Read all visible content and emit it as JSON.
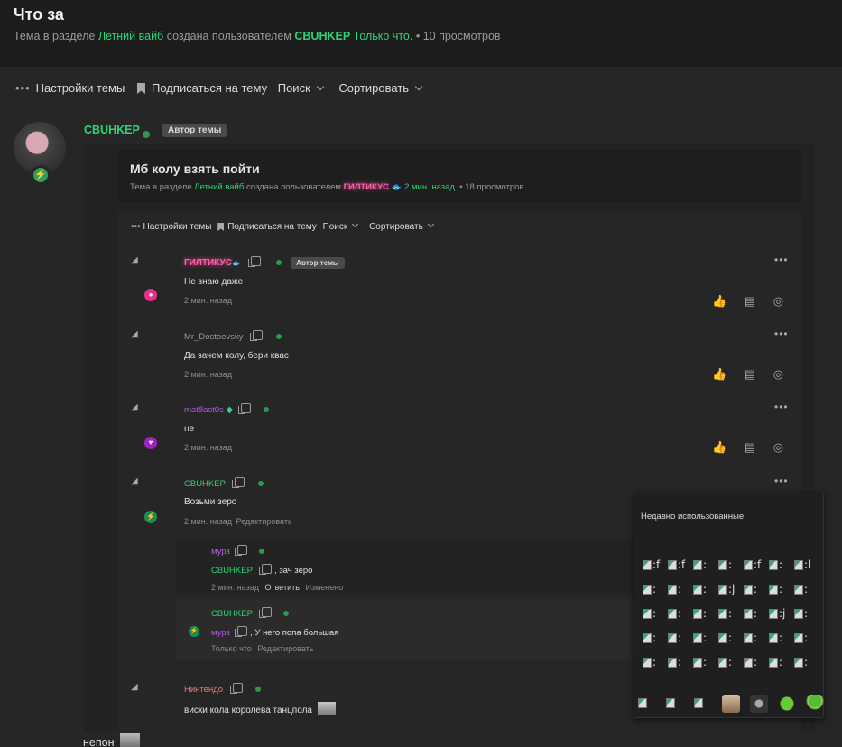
{
  "header": {
    "title": "Что за",
    "meta_prefix": "Тема в разделе",
    "section": "Летний вайб",
    "created_by": "создана пользователем",
    "author": "CBUHKEP",
    "time": "Только что.",
    "views": "• 10 просмотров"
  },
  "toolbar": {
    "settings": "Настройки темы",
    "subscribe": "Подписаться на тему",
    "search": "Поиск",
    "sort": "Сортировать"
  },
  "post": {
    "author": "CBUHKEP",
    "badge": "Автор темы",
    "avatar_badge": "bolt-icon"
  },
  "quoted_thread": {
    "title": "Мб колу взять пойти",
    "meta_prefix": "Тема в разделе",
    "section": "Летний вайб",
    "created_by": "создана пользователем",
    "author": "ГИЛТИКУС",
    "time": "2 мин. назад.",
    "views": "• 18 просмотров",
    "toolbar": {
      "settings": "Настройки темы",
      "subscribe": "Подписаться на тему",
      "search": "Поиск",
      "sort": "Сортировать"
    }
  },
  "comments": [
    {
      "author": "ГИЛТИКУС",
      "badge": "Автор темы",
      "text": "Не знаю даже",
      "time": "2 мин. назад",
      "icon": "apple-badge-icon"
    },
    {
      "author": "Mr_Dostoevsky",
      "text": "Да зачем колу, бери квас",
      "time": "2 мин. назад"
    },
    {
      "author": "mat8ast0s",
      "text": "не",
      "time": "2 мин. назад",
      "icon": "heart-badge-icon"
    },
    {
      "author": "CBUHKEP",
      "text": "Возьми зеро",
      "time": "2 мин. назад",
      "edit": "Редактировать",
      "icon": "bolt-badge-icon"
    },
    {
      "author": "Нинтендо",
      "text": "виски кола королева танцпола"
    }
  ],
  "replies": [
    {
      "author": "мурз",
      "quote_author": "CBUHKEP",
      "text": ", зач зеро",
      "time": "2 мин. назад",
      "reply": "Ответить",
      "changed": "Изменено"
    },
    {
      "author": "CBUHKEP",
      "quote_author": "мурз",
      "text": ", У него попа большая",
      "time": "Только что",
      "edit": "Редактировать"
    }
  ],
  "emoji_panel": {
    "title": "Недавно использованные",
    "rows": [
      [
        ":f",
        ":f",
        ":",
        ":",
        ":f",
        ":",
        ":l"
      ],
      [
        ":",
        ":",
        ":",
        ":j",
        ":",
        ":",
        ":"
      ],
      [
        ":",
        ":",
        ":",
        ":",
        ":",
        ":j",
        ":"
      ],
      [
        ":",
        ":",
        ":",
        ":",
        ":",
        ":",
        ":"
      ],
      [
        ":",
        ":",
        ":",
        ":",
        ":",
        ":",
        ":"
      ]
    ],
    "stickers": [
      "image",
      "image",
      "image",
      "cat-sticker",
      "monkey-sticker",
      "frog-sticker",
      "broccoli-sticker"
    ]
  },
  "footer_text": "непон",
  "colors": {
    "accent": "#2bd576",
    "bg": "#1c1c1c",
    "panel": "#262626"
  }
}
